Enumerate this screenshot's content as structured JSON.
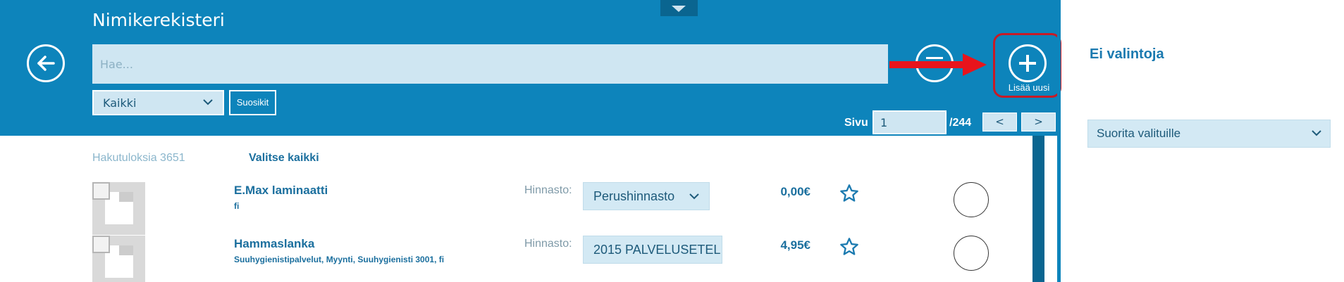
{
  "header": {
    "title": "Nimikerekisteri",
    "search_placeholder": "Hae...",
    "category_selected": "Kaikki",
    "favorites_label": "Suosikit",
    "add_new_label": "Lisää uusi",
    "icons": {
      "back": "back-arrow-icon",
      "filter": "filter-icon",
      "add": "plus-icon",
      "collapse": "chevron-down-icon"
    }
  },
  "pagination": {
    "label": "Sivu",
    "current_page": "1",
    "total": "/244",
    "prev_label": "<",
    "next_label": ">"
  },
  "results": {
    "count_label": "Hakutuloksia 3651",
    "select_all_label": "Valitse kaikki",
    "pricelist_label": "Hinnasto:",
    "items": [
      {
        "name": "E.Max laminaatti",
        "tags": "fi",
        "pricelist": "Perushinnasto",
        "price": "0,00€"
      },
      {
        "name": "Hammaslanka",
        "tags": "Suuhygienistipalvelut, Myynti, Suuhygienisti 3001, fi",
        "pricelist": "2015 PALVELUSETELI",
        "price": "4,95€"
      }
    ]
  },
  "side_panel": {
    "title": "Ei valintoja",
    "bulk_action_selected": "Suorita valituille"
  },
  "colors": {
    "header_bg": "#0d84bb",
    "accent_text": "#1b6f9e",
    "input_bg": "#cfe6f2",
    "highlight_red": "#c71a26"
  }
}
